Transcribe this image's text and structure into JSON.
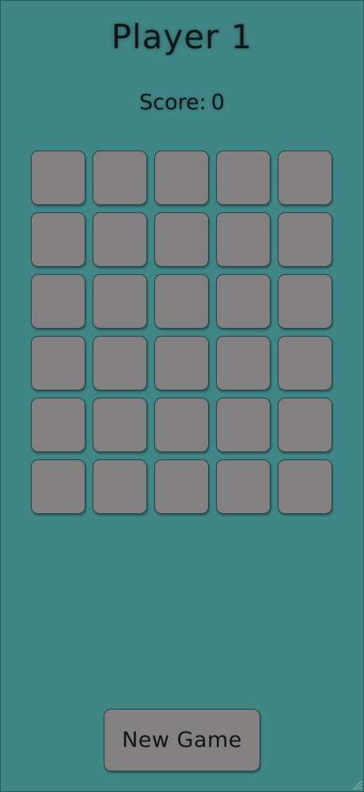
{
  "header": {
    "title": "Player 1",
    "score_label": "Score:",
    "score_value": "0"
  },
  "board": {
    "rows": 6,
    "columns": 5,
    "tiles_state": "face-down",
    "tile_color": "#828080"
  },
  "controls": {
    "new_game_label": "New Game"
  },
  "colors": {
    "background": "#418687",
    "tile": "#828080",
    "tile_border": "#1f4647",
    "text": "#101515"
  },
  "icons": {
    "resize_grip": "resize-grip-icon"
  }
}
